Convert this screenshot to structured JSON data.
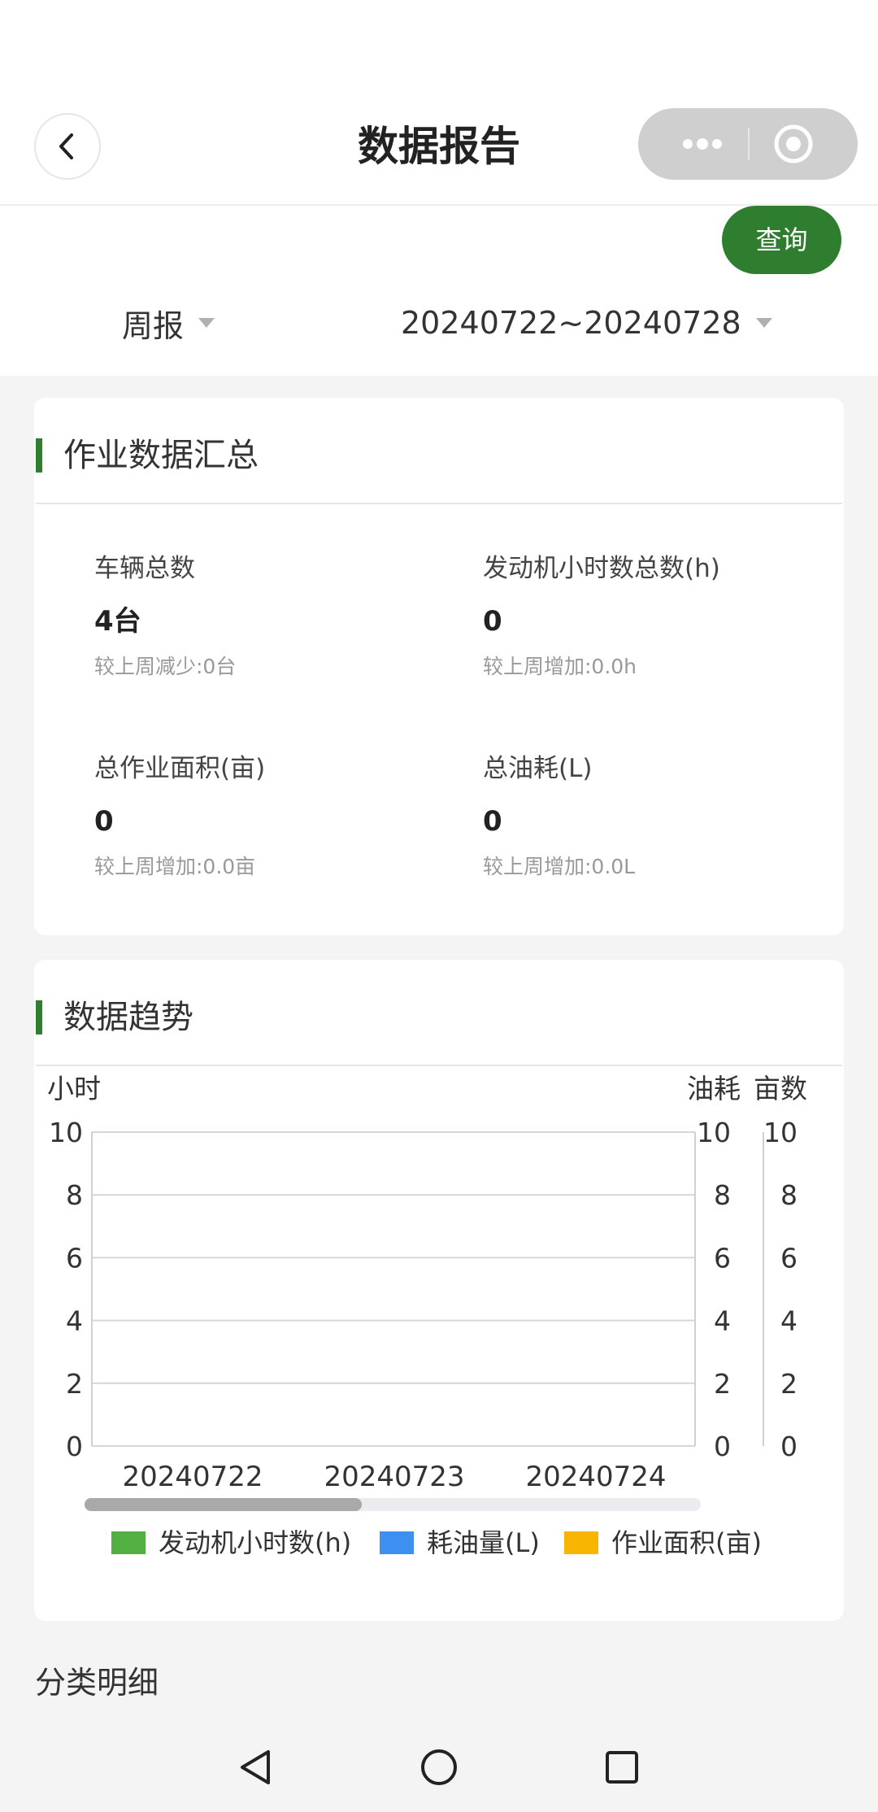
{
  "header": {
    "title": "数据报告",
    "back_icon": "chevron-left-icon",
    "more_icon": "more-dots-icon",
    "close_icon": "target-icon"
  },
  "toolbar": {
    "query_label": "查询",
    "period_value": "周报",
    "range_value": "20240722~20240728"
  },
  "summary": {
    "title": "作业数据汇总",
    "items": [
      {
        "label": "车辆总数",
        "value": "4台",
        "delta": "较上周减少:0台"
      },
      {
        "label": "发动机小时数总数(h)",
        "value": "0",
        "delta": "较上周增加:0.0h"
      },
      {
        "label": "总作业面积(亩)",
        "value": "0",
        "delta": "较上周增加:0.0亩"
      },
      {
        "label": "总油耗(L)",
        "value": "0",
        "delta": "较上周增加:0.0L"
      }
    ]
  },
  "trend": {
    "title": "数据趋势"
  },
  "chart_data": {
    "type": "bar",
    "categories": [
      "20240722",
      "20240723",
      "20240724"
    ],
    "series": [
      {
        "name": "发动机小时数(h)",
        "color": "#52b043",
        "axis": "小时",
        "values": [
          0,
          0,
          0
        ]
      },
      {
        "name": "耗油量(L)",
        "color": "#3d8ff0",
        "axis": "油耗",
        "values": [
          0,
          0,
          0
        ]
      },
      {
        "name": "作业面积(亩)",
        "color": "#f7b500",
        "axis": "亩数",
        "values": [
          0,
          0,
          0
        ]
      }
    ],
    "axes": {
      "left": {
        "label": "小时",
        "ticks": [
          "0",
          "2",
          "4",
          "6",
          "8",
          "10"
        ],
        "range": [
          0,
          10
        ]
      },
      "right1": {
        "label": "油耗",
        "ticks": [
          "0",
          "2",
          "4",
          "6",
          "8",
          "10"
        ],
        "range": [
          0,
          10
        ]
      },
      "right2": {
        "label": "亩数",
        "ticks": [
          "0",
          "2",
          "4",
          "6",
          "8",
          "10"
        ],
        "range": [
          0,
          10
        ]
      }
    },
    "grid": true,
    "legend": "bottom",
    "scroll_position": 0.45
  },
  "details": {
    "title": "分类明细"
  },
  "nav": {
    "back_icon": "triangle-back-icon",
    "home_icon": "circle-home-icon",
    "recent_icon": "square-recent-icon"
  }
}
